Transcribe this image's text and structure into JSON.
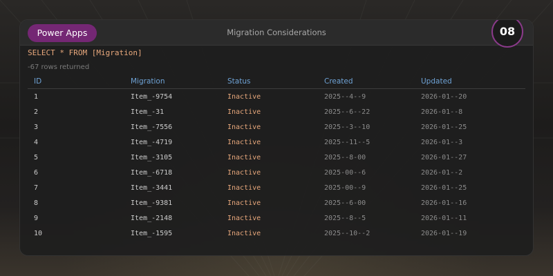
{
  "header": {
    "app_badge": "Power Apps",
    "title": "Migration Considerations",
    "slide_number": "08"
  },
  "query": {
    "text": "SELECT * FROM [Migration]",
    "rows_returned": "-67 rows returned"
  },
  "table": {
    "columns": [
      "ID",
      "Migration",
      "Status",
      "Created",
      "Updated"
    ],
    "rows": [
      {
        "id": "1",
        "migration": "Item_-9754",
        "status": "Inactive",
        "created": "2025--4--9",
        "updated": "2026-01--20"
      },
      {
        "id": "2",
        "migration": "Item_-31",
        "status": "Inactive",
        "created": "2025--6--22",
        "updated": "2026-01--8"
      },
      {
        "id": "3",
        "migration": "Item_-7556",
        "status": "Inactive",
        "created": "2025--3--10",
        "updated": "2026-01--25"
      },
      {
        "id": "4",
        "migration": "Item_-4719",
        "status": "Inactive",
        "created": "2025--11--5",
        "updated": "2026-01--3"
      },
      {
        "id": "5",
        "migration": "Item_-3105",
        "status": "Inactive",
        "created": "2025--8-00",
        "updated": "2026-01--27"
      },
      {
        "id": "6",
        "migration": "Item_-6718",
        "status": "Inactive",
        "created": "2025-00--6",
        "updated": "2026-01--2"
      },
      {
        "id": "7",
        "migration": "Item_-3441",
        "status": "Inactive",
        "created": "2025-00--9",
        "updated": "2026-01--25"
      },
      {
        "id": "8",
        "migration": "Item_-9381",
        "status": "Inactive",
        "created": "2025--6-00",
        "updated": "2026-01--16"
      },
      {
        "id": "9",
        "migration": "Item_-2148",
        "status": "Inactive",
        "created": "2025--8--5",
        "updated": "2026-01--11"
      },
      {
        "id": "10",
        "migration": "Item_-1595",
        "status": "Inactive",
        "created": "2025--10--2",
        "updated": "2026-01--19"
      }
    ]
  },
  "colors": {
    "brand_badge": "#742774",
    "query_text": "#e8a87c",
    "column_header": "#6fa3d6",
    "status_text": "#e8a87c"
  }
}
